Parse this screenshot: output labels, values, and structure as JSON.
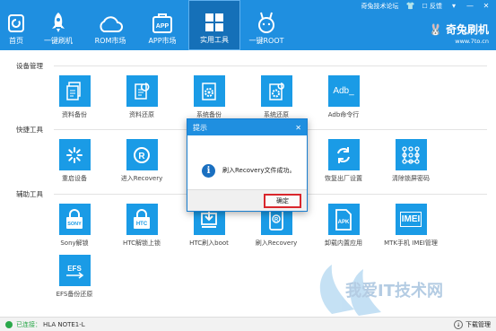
{
  "topstrip": {
    "forum": "奇兔技术论坛",
    "feedback": "反馈"
  },
  "nav": [
    {
      "label": "首页",
      "icon": "home-icon"
    },
    {
      "label": "一键刷机",
      "icon": "rocket-icon"
    },
    {
      "label": "ROM市场",
      "icon": "cloud-icon"
    },
    {
      "label": "APP市场",
      "icon": "app-bag-icon"
    },
    {
      "label": "实用工具",
      "icon": "grid-icon"
    },
    {
      "label": "一键ROOT",
      "icon": "rabbit-icon"
    }
  ],
  "brand": {
    "name": "奇兔刷机",
    "url": "www.7to.cn"
  },
  "sections": {
    "device": "设备管理",
    "shortcut": "快捷工具",
    "assist": "辅助工具"
  },
  "device_tools": [
    "资料备份",
    "资料还原",
    "系统备份",
    "系统还原",
    "Adb命令行"
  ],
  "shortcut_tools": [
    "重启设备",
    "进入Recovery",
    "恢复出厂设置",
    "清除锁屏密码"
  ],
  "assist_tools": [
    "Sony解锁",
    "HTC解锁上锁",
    "HTC刷入boot",
    "刷入Recovery",
    "卸载内置应用",
    "MTK手机 IMEI管理",
    "EFS备份还原"
  ],
  "icon_text": {
    "adb": "Adb_",
    "sony": "SONY",
    "htc": "HTC",
    "apk": "APK",
    "imei": "IMEI",
    "efs": "EFS"
  },
  "dialog": {
    "title": "提示",
    "message": "刷入Recovery文件成功。",
    "ok": "确定"
  },
  "status": {
    "connected": "已连接：",
    "device": "HLA NOTE1-L",
    "download": "下载管理"
  },
  "colors": {
    "topbar": "#1f8fe0",
    "tile": "#1a9be6",
    "highlight": "#d9262c"
  }
}
